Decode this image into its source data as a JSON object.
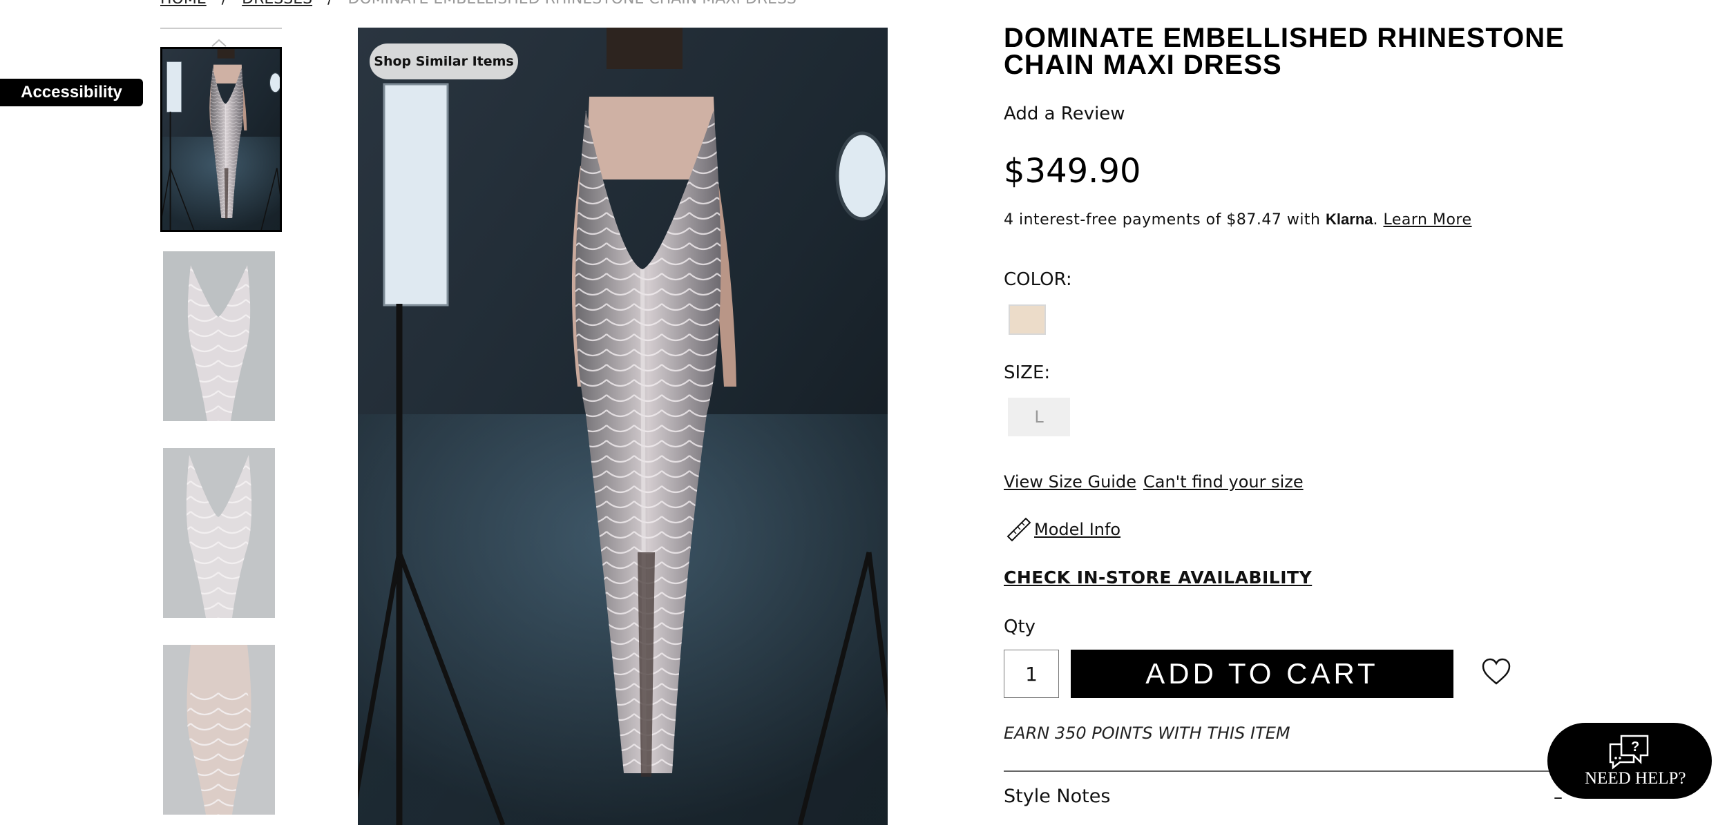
{
  "breadcrumb": {
    "items": [
      "HOME",
      "DRESSES"
    ],
    "separator": "/",
    "current": "DOMINATE EMBELLISHED RHINESTONE CHAIN MAXI DRESS"
  },
  "accessibility": {
    "label": "Accessibility"
  },
  "gallery": {
    "shop_similar_label": "Shop Similar Items",
    "thumbnail_count": 4,
    "active_thumbnail": 1
  },
  "product": {
    "title": "DOMINATE EMBELLISHED RHINESTONE CHAIN MAXI DRESS",
    "review_link": "Add a Review",
    "price": "$349.90",
    "klarna": {
      "prefix": "4 interest-free payments of $87.47 with",
      "brand": "Klarna",
      "suffix": ".",
      "learn_more": "Learn More"
    },
    "color": {
      "label": "COLOR:",
      "swatch_hex": "#ecdcc9"
    },
    "size": {
      "label": "SIZE:",
      "options": [
        "L"
      ]
    },
    "size_guide_link": "View Size Guide",
    "cant_find_size_link": "Can't find your size",
    "model_info_link": "Model Info",
    "instore_link": "CHECK IN-STORE AVAILABILITY",
    "qty": {
      "label": "Qty",
      "value": "1"
    },
    "add_to_cart": "ADD TO CART",
    "points_text": "EARN 350 POINTS WITH THIS ITEM",
    "style_notes": {
      "label": "Style Notes",
      "toggle": "–"
    }
  },
  "help_widget": {
    "label": "NEED HELP?"
  },
  "icons": {
    "wishlist": "heart-icon",
    "model_info": "ruler-icon",
    "help": "chat-question-icon",
    "thumb_scroll": "chevron-up-icon"
  },
  "colors": {
    "primary": "#000000",
    "background": "#ffffff",
    "swatch": "#ecdcc9",
    "size_button": "#efefef"
  }
}
